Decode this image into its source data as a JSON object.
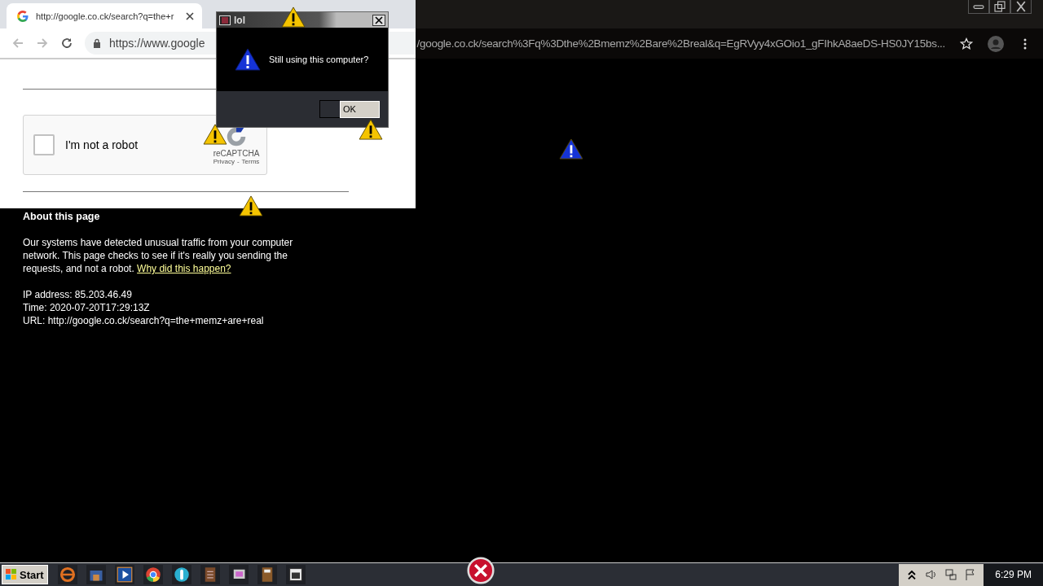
{
  "browser": {
    "tab_title": "http://google.co.ck/search?q=the+r",
    "address_start": "https://www.google",
    "address_rest": "/google.co.ck/search%3Fq%3Dthe%2Bmemz%2Bare%2Breal&q=EgRVyy4xGOio1_gFIhkA8aeDS-HS0JY15bs..."
  },
  "captcha": {
    "label": "I'm not a robot",
    "checked": false,
    "brand": "reCAPTCHA",
    "privacy": "Privacy",
    "separator": "-",
    "terms": "Terms"
  },
  "about": {
    "heading": "About this page",
    "text": "Our systems have detected unusual traffic from your computer network. This page checks to see if it's really you sending the requests, and not a robot.",
    "link": "Why did this happen?",
    "details": [
      "IP address: 85.203.46.49",
      "Time: 2020-07-20T17:29:13Z",
      "URL: http://google.co.ck/search?q=the+memz+are+real"
    ]
  },
  "dialog": {
    "title": "lol",
    "message": "Still using this computer?",
    "button": "OK"
  },
  "taskbar": {
    "start": "Start",
    "clock": "6:29 PM"
  }
}
